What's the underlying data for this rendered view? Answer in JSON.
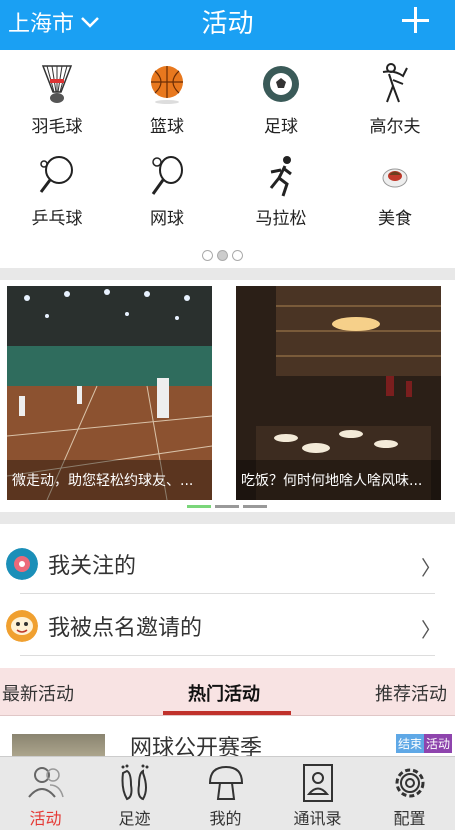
{
  "header": {
    "city": "上海市",
    "title": "活动"
  },
  "categories": [
    {
      "label": "羽毛球",
      "icon": "shuttlecock-icon"
    },
    {
      "label": "篮球",
      "icon": "basketball-icon"
    },
    {
      "label": "足球",
      "icon": "soccer-ball-icon"
    },
    {
      "label": "高尔夫",
      "icon": "golfer-icon"
    },
    {
      "label": "乒乓球",
      "icon": "ping-pong-icon"
    },
    {
      "label": "网球",
      "icon": "tennis-icon"
    },
    {
      "label": "马拉松",
      "icon": "runner-icon"
    },
    {
      "label": "美食",
      "icon": "food-plate-icon"
    }
  ],
  "category_pages": {
    "count": 3,
    "current": 1
  },
  "banners": [
    {
      "caption": "微走动，助您轻松约球友、..."
    },
    {
      "caption": "吃饭？何时何地啥人啥风味..."
    }
  ],
  "banner_pages": {
    "count": 3,
    "current": 1
  },
  "list": [
    {
      "label": "我关注的",
      "icon": "follow-icon"
    },
    {
      "label": "我被点名邀请的",
      "icon": "invite-mask-icon"
    }
  ],
  "tabs": [
    {
      "label": "最新活动"
    },
    {
      "label": "热门活动",
      "active": true
    },
    {
      "label": "推荐活动"
    }
  ],
  "activity": {
    "name": "网球公开赛季",
    "badges": [
      "结束",
      "活动"
    ]
  },
  "nav": [
    {
      "label": "活动",
      "icon": "people-icon",
      "active": true
    },
    {
      "label": "足迹",
      "icon": "footprints-icon"
    },
    {
      "label": "我的",
      "icon": "mushroom-icon"
    },
    {
      "label": "通讯录",
      "icon": "contacts-book-icon"
    },
    {
      "label": "配置",
      "icon": "gear-icon"
    }
  ],
  "colors": {
    "header": "#1aa0f3",
    "accent_red": "#e53935",
    "tab_bg": "#f8e3e3"
  }
}
